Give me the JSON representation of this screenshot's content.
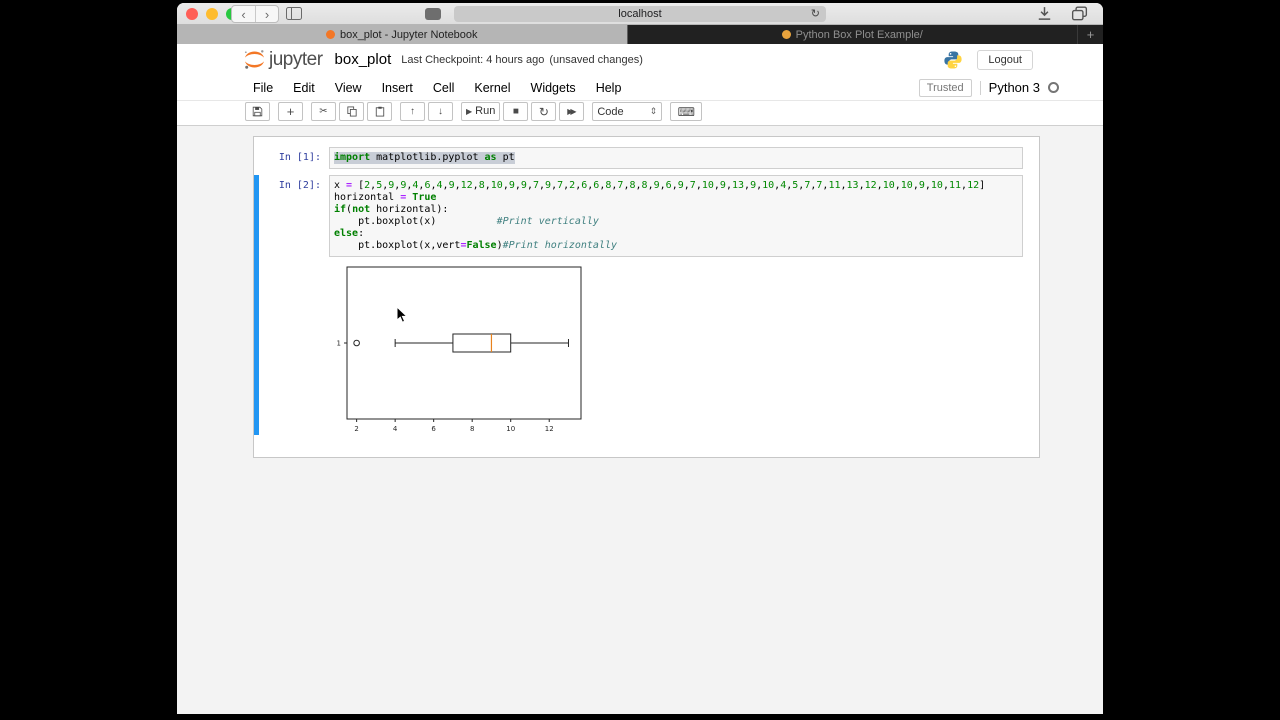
{
  "colors": {
    "traffic_close": "#ff5f57",
    "traffic_minimize": "#febc2e",
    "traffic_maximize": "#28c840",
    "selected_cell_accent": "#2196f3",
    "prompt_blue": "#303F9F",
    "jupyter_orange": "#f37726",
    "median_orange": "#e8821e"
  },
  "browser": {
    "url_text": "localhost",
    "tabs": [
      {
        "title": "box_plot - Jupyter Notebook"
      },
      {
        "title": "Python Box Plot Example/"
      }
    ],
    "new_tab_label": "+"
  },
  "icons": {
    "back": "‹",
    "forward": "›",
    "reload": "↻",
    "add": "+",
    "cut": "✂",
    "move_up": "↑",
    "move_down": "↓",
    "run": "▶",
    "stop": "■",
    "restart": "↻",
    "restart_run_all": "▶▶",
    "keyboard": "⌨",
    "select_caret": "⇕"
  },
  "header": {
    "logo_text": "jupyter",
    "notebook_title": "box_plot",
    "checkpoint": "Last Checkpoint: 4 hours ago",
    "unsaved": "(unsaved changes)",
    "logout_label": "Logout"
  },
  "menubar": {
    "items": [
      "File",
      "Edit",
      "View",
      "Insert",
      "Cell",
      "Kernel",
      "Widgets",
      "Help"
    ],
    "trusted_label": "Trusted",
    "kernel_name": "Python 3"
  },
  "toolbar": {
    "run_label": "Run",
    "cell_type_selected": "Code"
  },
  "cells": [
    {
      "prompt": "In [1]:",
      "highlight": true,
      "selected": false,
      "lines": [
        [
          {
            "t": "import",
            "y": "kw"
          },
          {
            "t": " matplotlib.pyplot ",
            "y": "txt"
          },
          {
            "t": "as",
            "y": "kw"
          },
          {
            "t": " pt",
            "y": "txt"
          }
        ]
      ]
    },
    {
      "prompt": "In [2]:",
      "highlight": false,
      "selected": true,
      "lines": [
        [
          {
            "t": "x ",
            "y": "txt"
          },
          {
            "t": "=",
            "y": "op"
          },
          {
            "t": " [",
            "y": "txt"
          },
          {
            "t": "2,5,9,9,4,6,4,9,12,8,10,9,9,7,9,7,2,6,6,8,7,8,8,9,6,9,7,10,9,13,9,10,4,5,7,7,11,13,12,10,10,9,10,11,12",
            "y": "nums"
          },
          {
            "t": "]",
            "y": "txt"
          }
        ],
        [
          {
            "t": "horizontal ",
            "y": "txt"
          },
          {
            "t": "=",
            "y": "op"
          },
          {
            "t": " ",
            "y": "txt"
          },
          {
            "t": "True",
            "y": "kw"
          }
        ],
        [
          {
            "t": "if",
            "y": "kw"
          },
          {
            "t": "(",
            "y": "txt"
          },
          {
            "t": "not",
            "y": "kw"
          },
          {
            "t": " horizontal):",
            "y": "txt"
          }
        ],
        [
          {
            "t": "    pt.boxplot(x)          ",
            "y": "txt"
          },
          {
            "t": "#Print vertically",
            "y": "cm"
          }
        ],
        [
          {
            "t": "else",
            "y": "kw"
          },
          {
            "t": ":",
            "y": "txt"
          }
        ],
        [
          {
            "t": "    pt.boxplot(x,vert",
            "y": "txt"
          },
          {
            "t": "=",
            "y": "op"
          },
          {
            "t": "False",
            "y": "kw"
          },
          {
            "t": ")",
            "y": "txt"
          },
          {
            "t": "#Print horizontally",
            "y": "cm"
          }
        ]
      ]
    }
  ],
  "chart_data": {
    "type": "boxplot",
    "orientation": "horizontal",
    "series": [
      {
        "name": "x",
        "whisker_low": 4,
        "q1": 7,
        "median": 9,
        "q3": 10,
        "whisker_high": 13,
        "outliers": [
          2
        ]
      }
    ],
    "x_ticks": [
      2,
      4,
      6,
      8,
      10,
      12
    ],
    "xlim": [
      1.5,
      13.65
    ],
    "y_ticks": [
      "1"
    ],
    "line_color": "#262626",
    "median_color": "#e8821e",
    "grid": false
  }
}
